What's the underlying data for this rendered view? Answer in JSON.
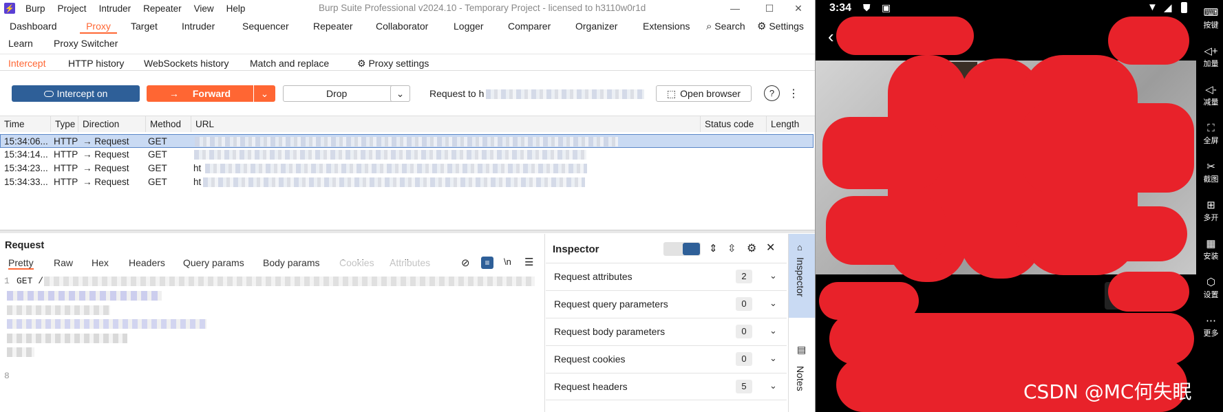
{
  "app": {
    "logo": "Burp",
    "menu": [
      "Burp",
      "Project",
      "Intruder",
      "Repeater",
      "View",
      "Help"
    ],
    "title": "Burp Suite Professional v2024.10 - Temporary Project - licensed to h3110w0r1d",
    "window_controls": {
      "minimize": "—",
      "maximize": "☐",
      "close": "✕"
    }
  },
  "main_tabs": {
    "row1": [
      "Dashboard",
      "Proxy",
      "Target",
      "Intruder",
      "Sequencer",
      "Repeater",
      "Collaborator",
      "Logger",
      "Comparer",
      "Organizer",
      "Extensions"
    ],
    "row2": [
      "Learn",
      "Proxy Switcher"
    ],
    "search": "Search",
    "settings": "Settings",
    "active": "Proxy"
  },
  "proxy_tabs": {
    "items": [
      "Intercept",
      "HTTP history",
      "WebSockets history",
      "Match and replace"
    ],
    "settings": "Proxy settings",
    "active": "Intercept"
  },
  "toolbar": {
    "intercept": "Intercept on",
    "forward": "Forward",
    "drop": "Drop",
    "request_to": "Request to h",
    "open_browser": "Open browser",
    "help": "?",
    "more": "⋮"
  },
  "history": {
    "columns": [
      "Time",
      "Type",
      "Direction",
      "Method",
      "URL",
      "Status code",
      "Length"
    ],
    "rows": [
      {
        "time": "15:34:06...",
        "type": "HTTP",
        "direction": "→ Request",
        "method": "GET",
        "url": ""
      },
      {
        "time": "15:34:14...",
        "type": "HTTP",
        "direction": "→ Request",
        "method": "GET",
        "url": ""
      },
      {
        "time": "15:34:23...",
        "type": "HTTP",
        "direction": "→ Request",
        "method": "GET",
        "url": "ht"
      },
      {
        "time": "15:34:33...",
        "type": "HTTP",
        "direction": "→ Request",
        "method": "GET",
        "url": "ht"
      }
    ]
  },
  "request": {
    "title": "Request",
    "tabs": [
      "Pretty",
      "Raw",
      "Hex",
      "Headers",
      "Query params",
      "Body params",
      "Cookies",
      "Attributes"
    ],
    "lines": [
      {
        "num": "1",
        "text": "GET /"
      },
      {
        "num": "8",
        "text": ""
      }
    ],
    "wrap": "\\n"
  },
  "inspector": {
    "title": "Inspector",
    "sections": [
      {
        "label": "Request attributes",
        "count": "2"
      },
      {
        "label": "Request query parameters",
        "count": "0"
      },
      {
        "label": "Request body parameters",
        "count": "0"
      },
      {
        "label": "Request cookies",
        "count": "0"
      },
      {
        "label": "Request headers",
        "count": "5"
      }
    ],
    "side_tabs": [
      "Inspector",
      "Notes"
    ]
  },
  "phone": {
    "time": "3:34",
    "watermark": "CSDN @MC何失眠"
  },
  "emulator_bar": [
    {
      "icon": "keyboard-icon",
      "label": "按键"
    },
    {
      "icon": "volume-up-icon",
      "label": "加量"
    },
    {
      "icon": "volume-down-icon",
      "label": "减量"
    },
    {
      "icon": "fullscreen-icon",
      "label": "全屏"
    },
    {
      "icon": "scissors-icon",
      "label": "截图"
    },
    {
      "icon": "multi-open-icon",
      "label": "多开"
    },
    {
      "icon": "apk-icon",
      "label": "安装"
    },
    {
      "icon": "settings-icon",
      "label": "设置"
    },
    {
      "icon": "more-icon",
      "label": "更多"
    }
  ],
  "colors": {
    "accent": "#ff6633",
    "intercept_blue": "#2e5f98",
    "selected_row": "#c9daf3",
    "redaction": "#e8222a"
  }
}
